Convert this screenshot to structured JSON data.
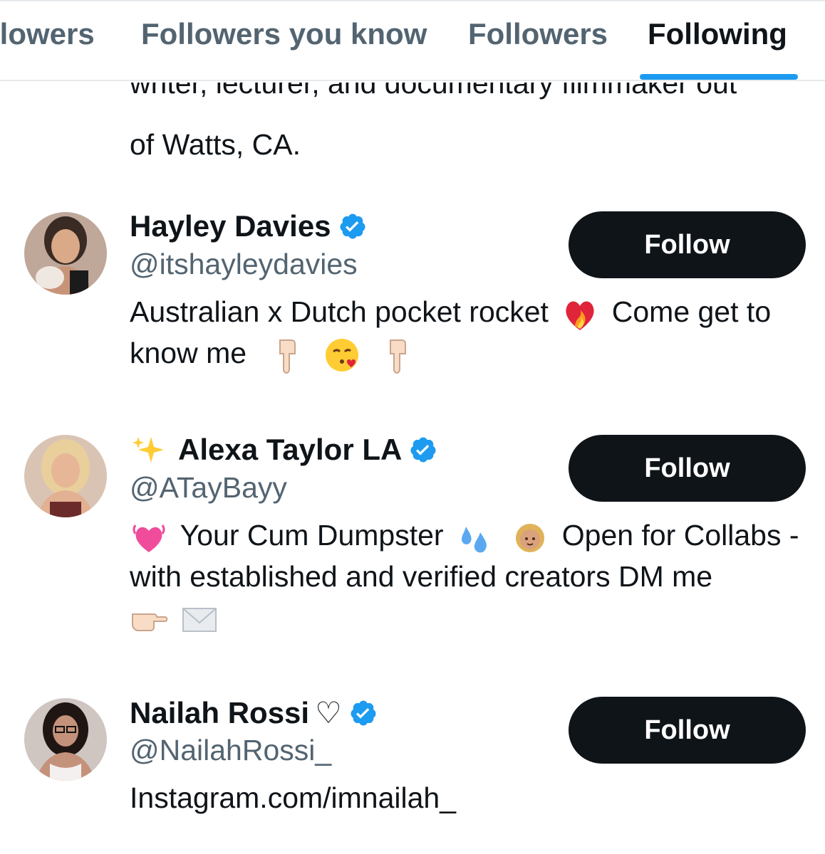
{
  "tabs": [
    {
      "label": "llowers",
      "active": false
    },
    {
      "label": "Followers you know",
      "active": false
    },
    {
      "label": "Followers",
      "active": false
    },
    {
      "label": "Following",
      "active": true
    }
  ],
  "accent_color": "#1d9bf0",
  "previous_bio": {
    "line1": "writer, lecturer, and documentary filmmaker out",
    "line2": "of Watts, CA."
  },
  "users": [
    {
      "name": "Hayley Davies",
      "handle": "@itshayleydavies",
      "verified": true,
      "bio_part1": "Australian x Dutch pocket rocket",
      "bio_part2": "Come get",
      "bio_part3": "to know me",
      "follow_label": "Follow",
      "bio_emojis": [
        "heart-on-fire-icon",
        "pointing-down-icon",
        "face-blowing-kiss-icon",
        "pointing-down-icon"
      ]
    },
    {
      "name": "Alexa Taylor LA",
      "handle": "@ATayBayy",
      "verified": true,
      "name_prefix_icon": "sparkles-icon",
      "bio_part1": "Your Cum Dumpster",
      "bio_part2": "Open for Collabs",
      "bio_part3": "- with established and verified creators DM me",
      "follow_label": "Follow",
      "bio_emojis": [
        "growing-heart-icon",
        "sweat-droplets-icon",
        "girl-icon",
        "pointing-right-icon",
        "envelope-icon"
      ]
    },
    {
      "name": "Nailah Rossi",
      "name_suffix": "♡",
      "handle": "@NailahRossi_",
      "verified": true,
      "bio_part1": "Instagram.com/imnailah_",
      "follow_label": "Follow"
    }
  ]
}
